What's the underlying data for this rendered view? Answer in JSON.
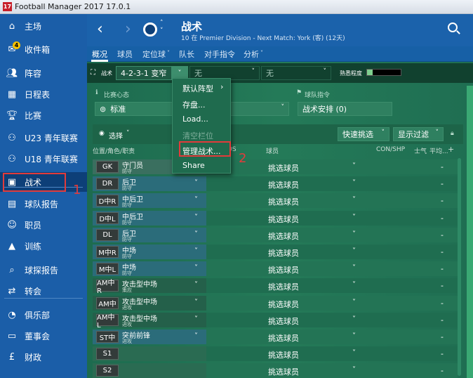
{
  "window": {
    "title": "Football Manager 2017 17.0.1",
    "logo_text": "17"
  },
  "sidebar": {
    "items": [
      {
        "label": "主场",
        "icon": "home-icon"
      },
      {
        "label": "收件箱",
        "icon": "inbox-icon",
        "badge": "4"
      },
      {
        "label": "阵容",
        "icon": "squad-icon"
      },
      {
        "label": "日程表",
        "icon": "calendar-icon"
      },
      {
        "label": "比赛",
        "icon": "trophy-icon"
      },
      {
        "label": "U23 青年联赛",
        "icon": "u23-icon"
      },
      {
        "label": "U18 青年联赛",
        "icon": "u18-icon"
      },
      {
        "label": "战术",
        "icon": "tactics-icon"
      },
      {
        "label": "球队报告",
        "icon": "report-icon"
      },
      {
        "label": "职员",
        "icon": "staff-icon"
      },
      {
        "label": "训练",
        "icon": "training-icon"
      },
      {
        "label": "球探报告",
        "icon": "scout-icon"
      },
      {
        "label": "转会",
        "icon": "transfer-icon"
      },
      {
        "label": "俱乐部",
        "icon": "club-icon"
      },
      {
        "label": "董事会",
        "icon": "board-icon"
      },
      {
        "label": "财政",
        "icon": "finance-icon"
      }
    ],
    "active_index": 7
  },
  "header": {
    "title": "战术",
    "subtitle": "10 在 Premier Division - Next Match: York (客) (12天)"
  },
  "tabs": [
    "概况",
    "球员",
    "定位球",
    "队长",
    "对手指令",
    "分析"
  ],
  "toolbar": {
    "tactic_label": "战术",
    "formation": "4-2-3-1 变窄",
    "slot2": "无",
    "slot3": "无",
    "familiarity_label": "熟悉程度"
  },
  "mentality": {
    "label": "比赛心态",
    "value": "标准"
  },
  "team_instructions": {
    "label": "球队指令",
    "value": "战术安排 (0)"
  },
  "selection": {
    "select_label": "选择",
    "quick_pick": "快速挑选",
    "filter": "显示过滤",
    "col_position": "位置/角色/职责",
    "col_ds": "DS",
    "col_player": "球员",
    "col_con": "CON/SHP",
    "col_morale": "士气",
    "col_avg": "平均..."
  },
  "dropdown_menu": [
    "默认阵型",
    "存盘...",
    "Load...",
    "清空栏位",
    "管理战术...",
    "Share"
  ],
  "annotations": [
    "1",
    "2"
  ],
  "rows": [
    {
      "pos": "GK",
      "role": "守门员",
      "duty": "防守",
      "player": "挑选球员",
      "value": "-"
    },
    {
      "pos": "DR",
      "role": "后卫",
      "duty": "防守",
      "player": "挑选球员",
      "value": "-"
    },
    {
      "pos": "D中R",
      "role": "中后卫",
      "duty": "防守",
      "player": "挑选球员",
      "value": "-"
    },
    {
      "pos": "D中L",
      "role": "中后卫",
      "duty": "防守",
      "player": "挑选球员",
      "value": "-"
    },
    {
      "pos": "DL",
      "role": "后卫",
      "duty": "防守",
      "player": "挑选球员",
      "value": "-"
    },
    {
      "pos": "M中R",
      "role": "中场",
      "duty": "防守",
      "player": "挑选球员",
      "value": "-"
    },
    {
      "pos": "M中L",
      "role": "中场",
      "duty": "防守",
      "player": "挑选球员",
      "value": "-"
    },
    {
      "pos": "AM中R",
      "role": "攻击型中场",
      "duty": "策应",
      "player": "挑选球员",
      "value": "-"
    },
    {
      "pos": "AM中",
      "role": "攻击型中场",
      "duty": "进攻",
      "player": "挑选球员",
      "value": "-"
    },
    {
      "pos": "AM中L",
      "role": "攻击型中场",
      "duty": "进攻",
      "player": "挑选球员",
      "value": "-"
    },
    {
      "pos": "ST中",
      "role": "突前前锋",
      "duty": "进攻",
      "player": "挑选球员",
      "value": "-"
    },
    {
      "pos": "S1",
      "role": "",
      "duty": "",
      "player": "挑选球员",
      "value": "-"
    },
    {
      "pos": "S2",
      "role": "",
      "duty": "",
      "player": "挑选球员",
      "value": "-"
    }
  ],
  "colors": {
    "sidebar": "#1b5ea8",
    "active": "#0d3f78",
    "pitch": "#247a58",
    "highlight": "#e23b3b"
  }
}
